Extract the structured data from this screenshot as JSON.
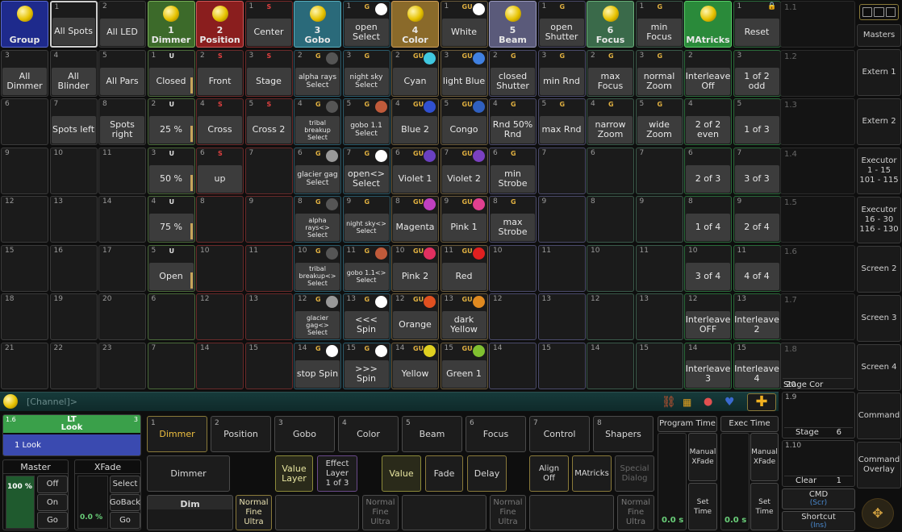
{
  "cells": [
    {
      "c": 0,
      "r": 0,
      "h": 1,
      "lbl": "Group",
      "bg": "#1e2a8c",
      "bd": "#5a6ad0"
    },
    {
      "c": 1,
      "r": 0,
      "num": "1",
      "lbl": "All Spots",
      "sel": true
    },
    {
      "c": 2,
      "r": 0,
      "num": "2",
      "lbl": "All LED"
    },
    {
      "c": 3,
      "r": 0,
      "h": 1,
      "lbl": "1\nDimmer",
      "bg": "#3c6a2a",
      "bd": "#7ab05a"
    },
    {
      "c": 4,
      "r": 0,
      "h": 1,
      "lbl": "2\nPosition",
      "bg": "#8a1e1e",
      "bd": "#d05a5a"
    },
    {
      "c": 5,
      "r": 0,
      "num": "1",
      "flag": "S",
      "fc": "#e04040",
      "lbl": "Center",
      "bd": "#7a2a2a"
    },
    {
      "c": 6,
      "r": 0,
      "h": 1,
      "lbl": "3\nGobo",
      "bg": "#2a6a7a",
      "bd": "#5ab0c0"
    },
    {
      "c": 7,
      "r": 0,
      "num": "1",
      "flag": "G",
      "fc": "#e0b040",
      "ball": "#ffffff",
      "lbl": "open\nSelect",
      "bd": "#2a5a6a"
    },
    {
      "c": 8,
      "r": 0,
      "h": 1,
      "lbl": "4\nColor",
      "bg": "#8a6a2a",
      "bd": "#d0a05a"
    },
    {
      "c": 9,
      "r": 0,
      "num": "1",
      "flag": "GU",
      "fc": "#e0b040",
      "ball": "#ffffff",
      "lbl": "White",
      "bd": "#6a5a3a"
    },
    {
      "c": 10,
      "r": 0,
      "h": 1,
      "lbl": "5\nBeam",
      "bg": "#5a5a7a",
      "bd": "#9a9ac0"
    },
    {
      "c": 11,
      "r": 0,
      "num": "1",
      "flag": "G",
      "fc": "#e0b040",
      "lbl": "open\nShutter",
      "bd": "#4a4a6a"
    },
    {
      "c": 12,
      "r": 0,
      "h": 1,
      "lbl": "6\nFocus",
      "bg": "#3a6a4a",
      "bd": "#6ab07a"
    },
    {
      "c": 13,
      "r": 0,
      "num": "1",
      "flag": "G",
      "fc": "#e0b040",
      "lbl": "min Focus",
      "bd": "#3a5a4a"
    },
    {
      "c": 14,
      "r": 0,
      "h": 1,
      "lbl": "MAtricks",
      "bg": "#2a8a3a",
      "bd": "#5ad06a"
    },
    {
      "c": 15,
      "r": 0,
      "num": "1",
      "lbl": "Reset",
      "bd": "#2a6a3a",
      "lock": true
    },
    {
      "c": 0,
      "r": 1,
      "num": "3",
      "lbl": "All\nDimmer"
    },
    {
      "c": 1,
      "r": 1,
      "num": "4",
      "lbl": "All Blinder"
    },
    {
      "c": 2,
      "r": 1,
      "num": "5",
      "lbl": "All Pars"
    },
    {
      "c": 3,
      "r": 1,
      "num": "1",
      "flag": "U",
      "fc": "#e0e0e0",
      "lbl": "Closed",
      "bar": 20,
      "bd": "#4a6a3a"
    },
    {
      "c": 4,
      "r": 1,
      "num": "2",
      "flag": "S",
      "fc": "#e04040",
      "lbl": "Front",
      "bd": "#6a2a2a"
    },
    {
      "c": 5,
      "r": 1,
      "num": "3",
      "flag": "S",
      "fc": "#e04040",
      "lbl": "Stage",
      "bd": "#6a2a2a"
    },
    {
      "c": 6,
      "r": 1,
      "num": "2",
      "flag": "G",
      "fc": "#e0b040",
      "ball": "#555555",
      "lbl": "alpha rays\nSelect",
      "sm": 1,
      "bd": "#2a5a6a"
    },
    {
      "c": 7,
      "r": 1,
      "num": "3",
      "flag": "G",
      "fc": "#e0b040",
      "lbl": "night sky\nSelect",
      "sm": 1,
      "bd": "#2a5a6a"
    },
    {
      "c": 8,
      "r": 1,
      "num": "2",
      "flag": "GU",
      "fc": "#e0b040",
      "ball": "#40c8e0",
      "lbl": "Cyan",
      "bd": "#6a5a3a"
    },
    {
      "c": 9,
      "r": 1,
      "num": "3",
      "flag": "GU",
      "fc": "#e0b040",
      "ball": "#4080e0",
      "lbl": "light Blue",
      "bd": "#6a5a3a"
    },
    {
      "c": 10,
      "r": 1,
      "num": "2",
      "flag": "G",
      "fc": "#e0b040",
      "lbl": "closed\nShutter",
      "bd": "#4a4a6a"
    },
    {
      "c": 11,
      "r": 1,
      "num": "3",
      "flag": "G",
      "fc": "#e0b040",
      "lbl": "min Rnd",
      "bd": "#4a4a6a"
    },
    {
      "c": 12,
      "r": 1,
      "num": "2",
      "flag": "G",
      "fc": "#e0b040",
      "lbl": "max\nFocus",
      "bd": "#3a5a4a"
    },
    {
      "c": 13,
      "r": 1,
      "num": "3",
      "flag": "G",
      "fc": "#e0b040",
      "lbl": "normal\nZoom",
      "bd": "#3a5a4a"
    },
    {
      "c": 14,
      "r": 1,
      "num": "2",
      "lbl": "Interleave\nOff",
      "bd": "#2a6a3a"
    },
    {
      "c": 15,
      "r": 1,
      "num": "3",
      "lbl": "1 of 2\nodd",
      "bd": "#2a6a3a"
    },
    {
      "c": 0,
      "r": 2,
      "num": "6",
      "lbl": ""
    },
    {
      "c": 1,
      "r": 2,
      "num": "7",
      "lbl": "Spots left"
    },
    {
      "c": 2,
      "r": 2,
      "num": "8",
      "lbl": "Spots\nright"
    },
    {
      "c": 3,
      "r": 2,
      "num": "2",
      "flag": "U",
      "fc": "#e0e0e0",
      "lbl": "25 %",
      "bar": 20,
      "bd": "#4a6a3a"
    },
    {
      "c": 4,
      "r": 2,
      "num": "4",
      "flag": "S",
      "fc": "#e04040",
      "lbl": "Cross",
      "bd": "#6a2a2a"
    },
    {
      "c": 5,
      "r": 2,
      "num": "5",
      "flag": "S",
      "fc": "#e04040",
      "lbl": "Cross 2",
      "bd": "#6a2a2a"
    },
    {
      "c": 6,
      "r": 2,
      "num": "4",
      "flag": "G",
      "fc": "#e0b040",
      "ball": "#555555",
      "lbl": "tribal\nbreakup\nSelect",
      "xs": 1,
      "bd": "#2a5a6a"
    },
    {
      "c": 7,
      "r": 2,
      "num": "5",
      "flag": "G",
      "fc": "#e0b040",
      "ball": "#c05a3a",
      "lbl": "gobo 1.1\nSelect",
      "sm": 1,
      "bd": "#2a5a6a"
    },
    {
      "c": 8,
      "r": 2,
      "num": "4",
      "flag": "GU",
      "fc": "#e0b040",
      "ball": "#3050d0",
      "lbl": "Blue 2",
      "bd": "#6a5a3a"
    },
    {
      "c": 9,
      "r": 2,
      "num": "5",
      "flag": "GU",
      "fc": "#e0b040",
      "ball": "#3060c0",
      "lbl": "Congo",
      "bd": "#6a5a3a"
    },
    {
      "c": 10,
      "r": 2,
      "num": "4",
      "flag": "G",
      "fc": "#e0b040",
      "lbl": "Rnd 50%\nRnd",
      "bd": "#4a4a6a"
    },
    {
      "c": 11,
      "r": 2,
      "num": "5",
      "flag": "G",
      "fc": "#e0b040",
      "lbl": "max Rnd",
      "bd": "#4a4a6a"
    },
    {
      "c": 12,
      "r": 2,
      "num": "4",
      "flag": "G",
      "fc": "#e0b040",
      "lbl": "narrow\nZoom",
      "bd": "#3a5a4a"
    },
    {
      "c": 13,
      "r": 2,
      "num": "5",
      "flag": "G",
      "fc": "#e0b040",
      "lbl": "wide\nZoom",
      "bd": "#3a5a4a"
    },
    {
      "c": 14,
      "r": 2,
      "num": "4",
      "lbl": "2 of 2\neven",
      "bd": "#2a6a3a"
    },
    {
      "c": 15,
      "r": 2,
      "num": "5",
      "lbl": "1 of 3",
      "bd": "#2a6a3a"
    },
    {
      "c": 0,
      "r": 3,
      "num": "9"
    },
    {
      "c": 1,
      "r": 3,
      "num": "10"
    },
    {
      "c": 2,
      "r": 3,
      "num": "11"
    },
    {
      "c": 3,
      "r": 3,
      "num": "3",
      "flag": "U",
      "fc": "#e0e0e0",
      "lbl": "50 %",
      "bar": 20,
      "bd": "#4a6a3a"
    },
    {
      "c": 4,
      "r": 3,
      "num": "6",
      "flag": "S",
      "fc": "#e04040",
      "lbl": "up",
      "bd": "#6a2a2a"
    },
    {
      "c": 5,
      "r": 3,
      "num": "7",
      "bd": "#6a2a2a"
    },
    {
      "c": 6,
      "r": 3,
      "num": "6",
      "flag": "G",
      "fc": "#e0b040",
      "ball": "#999999",
      "lbl": "glacier gag\nSelect",
      "sm": 1,
      "bd": "#2a5a6a"
    },
    {
      "c": 7,
      "r": 3,
      "num": "7",
      "flag": "G",
      "fc": "#e0b040",
      "ball": "#ffffff",
      "lbl": "open<>\nSelect",
      "bd": "#2a5a6a"
    },
    {
      "c": 8,
      "r": 3,
      "num": "6",
      "flag": "GU",
      "fc": "#e0b040",
      "ball": "#6a40c0",
      "lbl": "Violet 1",
      "bd": "#6a5a3a"
    },
    {
      "c": 9,
      "r": 3,
      "num": "7",
      "flag": "GU",
      "fc": "#e0b040",
      "ball": "#7a40c0",
      "lbl": "Violet 2",
      "bd": "#6a5a3a"
    },
    {
      "c": 10,
      "r": 3,
      "num": "6",
      "flag": "G",
      "fc": "#e0b040",
      "lbl": "min\nStrobe",
      "bd": "#4a4a6a"
    },
    {
      "c": 11,
      "r": 3,
      "num": "7",
      "bd": "#4a4a6a"
    },
    {
      "c": 12,
      "r": 3,
      "num": "6",
      "bd": "#3a5a4a"
    },
    {
      "c": 13,
      "r": 3,
      "num": "7",
      "bd": "#3a5a4a"
    },
    {
      "c": 14,
      "r": 3,
      "num": "6",
      "lbl": "2 of 3",
      "bd": "#2a6a3a"
    },
    {
      "c": 15,
      "r": 3,
      "num": "7",
      "lbl": "3 of 3",
      "bd": "#2a6a3a"
    },
    {
      "c": 0,
      "r": 4,
      "num": "12"
    },
    {
      "c": 1,
      "r": 4,
      "num": "13"
    },
    {
      "c": 2,
      "r": 4,
      "num": "14"
    },
    {
      "c": 3,
      "r": 4,
      "num": "4",
      "flag": "U",
      "fc": "#e0e0e0",
      "lbl": "75 %",
      "bar": 20,
      "bd": "#4a6a3a"
    },
    {
      "c": 4,
      "r": 4,
      "num": "8",
      "bd": "#6a2a2a"
    },
    {
      "c": 5,
      "r": 4,
      "num": "9",
      "bd": "#6a2a2a"
    },
    {
      "c": 6,
      "r": 4,
      "num": "8",
      "flag": "G",
      "fc": "#e0b040",
      "ball": "#555555",
      "lbl": "alpha rays<>\nSelect",
      "xs": 1,
      "bd": "#2a5a6a"
    },
    {
      "c": 7,
      "r": 4,
      "num": "9",
      "flag": "G",
      "fc": "#e0b040",
      "lbl": "night sky<>\nSelect",
      "xs": 1,
      "bd": "#2a5a6a"
    },
    {
      "c": 8,
      "r": 4,
      "num": "8",
      "flag": "GU",
      "fc": "#e0b040",
      "ball": "#c040c0",
      "lbl": "Magenta",
      "bd": "#6a5a3a"
    },
    {
      "c": 9,
      "r": 4,
      "num": "9",
      "flag": "GU",
      "fc": "#e0b040",
      "ball": "#e04090",
      "lbl": "Pink 1",
      "bd": "#6a5a3a"
    },
    {
      "c": 10,
      "r": 4,
      "num": "8",
      "flag": "G",
      "fc": "#e0b040",
      "lbl": "max\nStrobe",
      "bd": "#4a4a6a"
    },
    {
      "c": 11,
      "r": 4,
      "num": "9",
      "bd": "#4a4a6a"
    },
    {
      "c": 12,
      "r": 4,
      "num": "8",
      "bd": "#3a5a4a"
    },
    {
      "c": 13,
      "r": 4,
      "num": "9",
      "bd": "#3a5a4a"
    },
    {
      "c": 14,
      "r": 4,
      "num": "8",
      "lbl": "1 of 4",
      "bd": "#2a6a3a"
    },
    {
      "c": 15,
      "r": 4,
      "num": "9",
      "lbl": "2 of 4",
      "bd": "#2a6a3a"
    },
    {
      "c": 0,
      "r": 5,
      "num": "15"
    },
    {
      "c": 1,
      "r": 5,
      "num": "16"
    },
    {
      "c": 2,
      "r": 5,
      "num": "17"
    },
    {
      "c": 3,
      "r": 5,
      "num": "5",
      "flag": "U",
      "fc": "#e0e0e0",
      "lbl": "Open",
      "bar": 20,
      "bd": "#4a6a3a"
    },
    {
      "c": 4,
      "r": 5,
      "num": "10",
      "bd": "#6a2a2a"
    },
    {
      "c": 5,
      "r": 5,
      "num": "11",
      "bd": "#6a2a2a"
    },
    {
      "c": 6,
      "r": 5,
      "num": "10",
      "flag": "G",
      "fc": "#e0b040",
      "ball": "#555555",
      "lbl": "tribal\nbreakup<>\nSelect",
      "xs": 1,
      "bd": "#2a5a6a"
    },
    {
      "c": 7,
      "r": 5,
      "num": "11",
      "flag": "G",
      "fc": "#e0b040",
      "ball": "#c05a3a",
      "lbl": "gobo 1.1<>\nSelect",
      "xs": 1,
      "bd": "#2a5a6a"
    },
    {
      "c": 8,
      "r": 5,
      "num": "10",
      "flag": "GU",
      "fc": "#e0b040",
      "ball": "#e03060",
      "lbl": "Pink 2",
      "bd": "#6a5a3a"
    },
    {
      "c": 9,
      "r": 5,
      "num": "11",
      "flag": "GU",
      "fc": "#e0b040",
      "ball": "#e02020",
      "lbl": "Red",
      "bd": "#6a5a3a"
    },
    {
      "c": 10,
      "r": 5,
      "num": "10",
      "bd": "#4a4a6a"
    },
    {
      "c": 11,
      "r": 5,
      "num": "11",
      "bd": "#4a4a6a"
    },
    {
      "c": 12,
      "r": 5,
      "num": "10",
      "bd": "#3a5a4a"
    },
    {
      "c": 13,
      "r": 5,
      "num": "11",
      "bd": "#3a5a4a"
    },
    {
      "c": 14,
      "r": 5,
      "num": "10",
      "lbl": "3 of 4",
      "bd": "#2a6a3a"
    },
    {
      "c": 15,
      "r": 5,
      "num": "11",
      "lbl": "4 of 4",
      "bd": "#2a6a3a"
    },
    {
      "c": 0,
      "r": 6,
      "num": "18"
    },
    {
      "c": 1,
      "r": 6,
      "num": "19"
    },
    {
      "c": 2,
      "r": 6,
      "num": "20"
    },
    {
      "c": 3,
      "r": 6,
      "num": "6",
      "bd": "#4a6a3a"
    },
    {
      "c": 4,
      "r": 6,
      "num": "12",
      "bd": "#6a2a2a"
    },
    {
      "c": 5,
      "r": 6,
      "num": "13",
      "bd": "#6a2a2a"
    },
    {
      "c": 6,
      "r": 6,
      "num": "12",
      "flag": "G",
      "fc": "#e0b040",
      "ball": "#999999",
      "lbl": "glacier\ngag<>\nSelect",
      "xs": 1,
      "bd": "#2a5a6a"
    },
    {
      "c": 7,
      "r": 6,
      "num": "13",
      "flag": "G",
      "fc": "#e0b040",
      "ball": "#ffffff",
      "lbl": "<<< Spin",
      "bd": "#2a5a6a"
    },
    {
      "c": 8,
      "r": 6,
      "num": "12",
      "flag": "GU",
      "fc": "#e0b040",
      "ball": "#e05020",
      "lbl": "Orange",
      "bd": "#6a5a3a"
    },
    {
      "c": 9,
      "r": 6,
      "num": "13",
      "flag": "GU",
      "fc": "#e0b040",
      "ball": "#e08a20",
      "lbl": "dark\nYellow",
      "bd": "#6a5a3a"
    },
    {
      "c": 10,
      "r": 6,
      "num": "12",
      "bd": "#4a4a6a"
    },
    {
      "c": 11,
      "r": 6,
      "num": "13",
      "bd": "#4a4a6a"
    },
    {
      "c": 12,
      "r": 6,
      "num": "12",
      "bd": "#3a5a4a"
    },
    {
      "c": 13,
      "r": 6,
      "num": "13",
      "bd": "#3a5a4a"
    },
    {
      "c": 14,
      "r": 6,
      "num": "12",
      "lbl": "Interleave\nOFF",
      "bd": "#2a6a3a"
    },
    {
      "c": 15,
      "r": 6,
      "num": "13",
      "lbl": "Interleave\n2",
      "bd": "#2a6a3a"
    },
    {
      "c": 0,
      "r": 7,
      "num": "21"
    },
    {
      "c": 1,
      "r": 7,
      "num": "22"
    },
    {
      "c": 2,
      "r": 7,
      "num": "23"
    },
    {
      "c": 3,
      "r": 7,
      "num": "7",
      "bd": "#4a6a3a"
    },
    {
      "c": 4,
      "r": 7,
      "num": "14",
      "bd": "#6a2a2a"
    },
    {
      "c": 5,
      "r": 7,
      "num": "15",
      "bd": "#6a2a2a"
    },
    {
      "c": 6,
      "r": 7,
      "num": "14",
      "flag": "G",
      "fc": "#e0b040",
      "ball": "#ffffff",
      "lbl": "stop Spin",
      "bd": "#2a5a6a"
    },
    {
      "c": 7,
      "r": 7,
      "num": "15",
      "flag": "G",
      "fc": "#e0b040",
      "ball": "#ffffff",
      "lbl": ">>> Spin",
      "bd": "#2a5a6a"
    },
    {
      "c": 8,
      "r": 7,
      "num": "14",
      "flag": "GU",
      "fc": "#e0b040",
      "ball": "#e0d020",
      "lbl": "Yellow",
      "bd": "#6a5a3a"
    },
    {
      "c": 9,
      "r": 7,
      "num": "15",
      "flag": "GU",
      "fc": "#e0b040",
      "ball": "#80c030",
      "lbl": "Green 1",
      "bd": "#6a5a3a"
    },
    {
      "c": 10,
      "r": 7,
      "num": "14",
      "bd": "#4a4a6a"
    },
    {
      "c": 11,
      "r": 7,
      "num": "15",
      "bd": "#4a4a6a"
    },
    {
      "c": 12,
      "r": 7,
      "num": "14",
      "bd": "#3a5a4a"
    },
    {
      "c": 13,
      "r": 7,
      "num": "15",
      "bd": "#3a5a4a"
    },
    {
      "c": 14,
      "r": 7,
      "num": "14",
      "lbl": "Interleave\n3",
      "bd": "#2a6a3a"
    },
    {
      "c": 15,
      "r": 7,
      "num": "15",
      "lbl": "Interleave\n4",
      "bd": "#2a6a3a"
    }
  ],
  "right_views": {
    "labels": [
      "1.1",
      "1.2",
      "1.3",
      "1.4",
      "1.5",
      "1.6",
      "1.7",
      "1.8"
    ],
    "stage_cor_label": "Stage Cor",
    "stage_cor_value": "20"
  },
  "side_buttons": [
    "Masters",
    "Extern 1",
    "Extern 2",
    "Executor\n1 - 15\n101 - 115",
    "Executor\n16 - 30\n116 - 130",
    "Screen 2",
    "Screen 3",
    "Screen 4",
    "Command",
    "Command\nOverlay"
  ],
  "command_line": {
    "prompt": "[Channel]>"
  },
  "bottom": {
    "view_19": "1.9",
    "stage_label": "Stage",
    "stage_value": "6",
    "view_110": "1.10",
    "clear_label": "Clear",
    "clear_value": "1",
    "cmd_label": "CMD",
    "cmd_sub": "(Scr)",
    "shortcut_label": "Shortcut",
    "shortcut_sub": "(Ins)"
  },
  "executor": {
    "id": "1.6",
    "title": "LT\nLook",
    "count": "3",
    "look": "1 Look"
  },
  "master": {
    "title": "Master",
    "value": "100 %",
    "buttons": [
      "Off",
      "On",
      "Go"
    ]
  },
  "xfade": {
    "title": "XFade",
    "value": "0.0 %",
    "buttons": [
      "Select",
      "GoBack",
      "Go"
    ]
  },
  "feature_tabs": [
    {
      "num": "1",
      "label": "Dimmer"
    },
    {
      "num": "2",
      "label": "Position"
    },
    {
      "num": "3",
      "label": "Gobo"
    },
    {
      "num": "4",
      "label": "Color"
    },
    {
      "num": "5",
      "label": "Beam"
    },
    {
      "num": "6",
      "label": "Focus"
    },
    {
      "num": "7",
      "label": "Control"
    },
    {
      "num": "8",
      "label": "Shapers"
    }
  ],
  "encoder_buttons": {
    "dimmer": "Dimmer",
    "value_layer": "Value\nLayer",
    "effect_layer": "Effect\nLayer\n1 of 3",
    "value": "Value",
    "fade": "Fade",
    "delay": "Delay",
    "align": "Align\nOff",
    "matricks": "MAtricks",
    "special": "Special\nDialog",
    "dim": "Dim",
    "normal_fine_ultra": "Normal\nFine\nUltra"
  },
  "timing": {
    "program_time": "Program Time",
    "exec_time": "Exec Time",
    "manual_xfade": "Manual\nXFade",
    "set_time": "Set\nTime",
    "program_value": "0.0 s",
    "exec_value": "0.0 s"
  }
}
